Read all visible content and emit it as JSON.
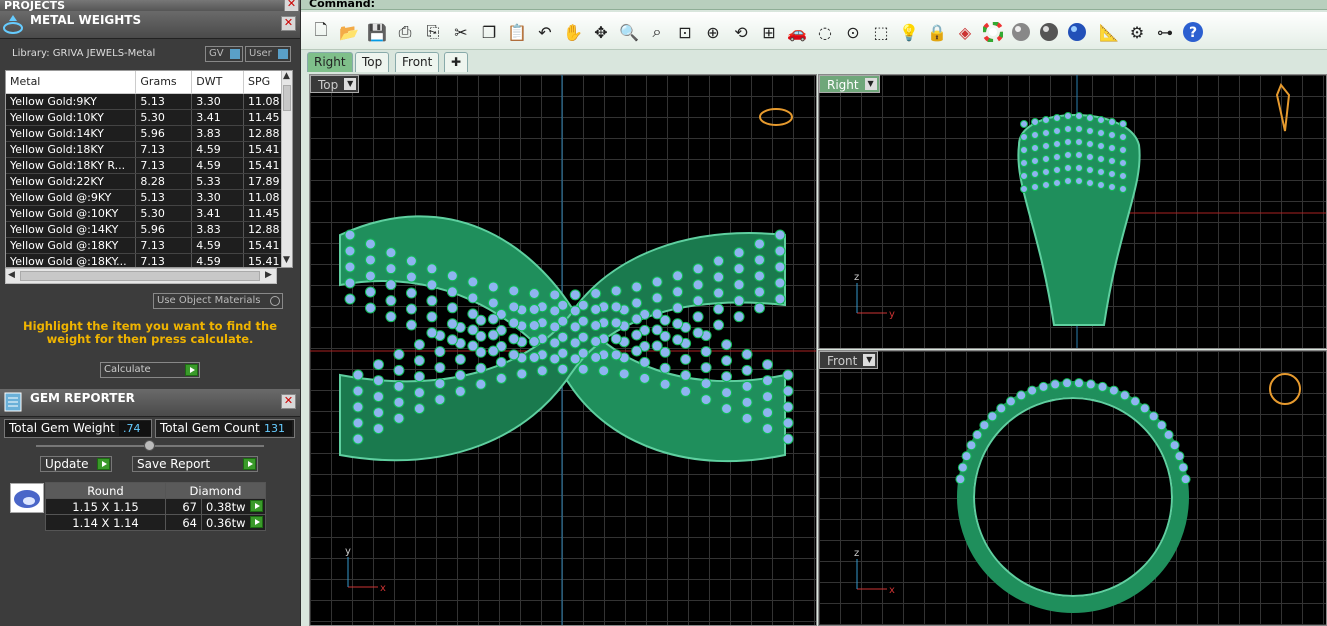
{
  "projects": {
    "title": "PROJECTS"
  },
  "metal_weights": {
    "title": "METAL WEIGHTS",
    "library": "Library: GRIVA JEWELS-Metal",
    "toggle_gv": "GV",
    "toggle_user": "User",
    "columns": [
      "Metal",
      "Grams",
      "DWT",
      "SPG"
    ],
    "rows": [
      [
        "Yellow Gold:9KY",
        "5.13",
        "3.30",
        "11.08"
      ],
      [
        "Yellow Gold:10KY",
        "5.30",
        "3.41",
        "11.45"
      ],
      [
        "Yellow Gold:14KY",
        "5.96",
        "3.83",
        "12.88"
      ],
      [
        "Yellow Gold:18KY",
        "7.13",
        "4.59",
        "15.41"
      ],
      [
        "Yellow Gold:18KY R...",
        "7.13",
        "4.59",
        "15.41"
      ],
      [
        "Yellow Gold:22KY",
        "8.28",
        "5.33",
        "17.89"
      ],
      [
        "Yellow Gold @:9KY",
        "5.13",
        "3.30",
        "11.08"
      ],
      [
        "Yellow Gold @:10KY",
        "5.30",
        "3.41",
        "11.45"
      ],
      [
        "Yellow Gold @:14KY",
        "5.96",
        "3.83",
        "12.88"
      ],
      [
        "Yellow Gold @:18KY",
        "7.13",
        "4.59",
        "15.41"
      ],
      [
        "Yellow Gold @:18KY...",
        "7.13",
        "4.59",
        "15.41"
      ]
    ],
    "use_object_materials": "Use Object Materials",
    "hint": "Highlight the item you want to find the weight for then press calculate.",
    "calculate": "Calculate"
  },
  "gem_reporter": {
    "title": "GEM REPORTER",
    "total_weight_label": "Total Gem Weight",
    "total_weight_value": ".74",
    "total_count_label": "Total Gem Count",
    "total_count_value": "131",
    "update": "Update",
    "save_report": "Save Report",
    "headers": [
      "Round",
      "Diamond"
    ],
    "rows": [
      [
        "1.15 X 1.15",
        "67",
        "0.38tw"
      ],
      [
        "1.14 X 1.14",
        "64",
        "0.36tw"
      ]
    ]
  },
  "command": {
    "label": "Command:"
  },
  "tabs": [
    "Right",
    "Top",
    "Front"
  ],
  "viewports": {
    "top": "Top",
    "right": "Right",
    "front": "Front"
  },
  "axes": {
    "x": "x",
    "y": "y",
    "z": "z"
  },
  "colors": {
    "accent": "#6fa77a",
    "hint": "#f0b400",
    "metal": "#1f8f5c",
    "gem": "#8fb4f0"
  }
}
